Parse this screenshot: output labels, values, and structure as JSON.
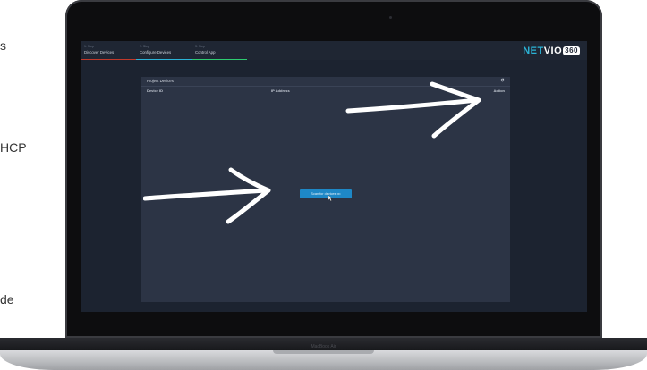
{
  "page_side_text": [
    "s",
    "HCP",
    "de"
  ],
  "laptop": {
    "model_label": "MacBook Air"
  },
  "app": {
    "tabs": [
      {
        "number": "1. Step",
        "label": "Discover Devices",
        "accent": "#c0392b"
      },
      {
        "number": "2. Step",
        "label": "Configure Devices",
        "accent": "#2bb3d6"
      },
      {
        "number": "3. Step",
        "label": "Control App",
        "accent": "#2ecc71"
      }
    ],
    "brand": {
      "part1": "NET",
      "part2": "VIO",
      "badge": "360"
    },
    "panel": {
      "title": "Project Devices",
      "columns": [
        "Device ID",
        "IP Address",
        "Action"
      ],
      "scan_button": "Scan for devices"
    }
  },
  "colors": {
    "screen_bg": "#1c2330",
    "panel_bg": "#2c3445",
    "accent_blue": "#1e88c7",
    "brand_cyan": "#2bb3d6",
    "annotation_arrow": "#ffffff"
  },
  "icons": [
    "refresh-icon",
    "cursor-icon",
    "arrow-annotation-icon"
  ]
}
